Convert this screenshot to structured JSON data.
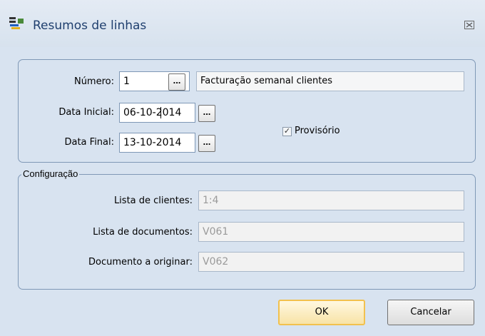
{
  "window": {
    "title": "Resumos de linhas"
  },
  "form": {
    "numero_label": "Número:",
    "numero_value": "1",
    "numero_desc": "Facturação semanal clientes",
    "data_inicial_label": "Data Inicial:",
    "data_inicial_value": "06-10-2014",
    "data_final_label": "Data Final:",
    "data_final_value": "13-10-2014",
    "provisorio_label": "Provisório",
    "provisorio_checked": true,
    "browse_label": "..."
  },
  "config": {
    "legend": "Configuração",
    "lista_clientes_label": "Lista de clientes:",
    "lista_clientes_value": "1:4",
    "lista_documentos_label": "Lista de documentos:",
    "lista_documentos_value": "V061",
    "documento_originar_label": "Documento a originar:",
    "documento_originar_value": "V062"
  },
  "buttons": {
    "ok": "OK",
    "cancel": "Cancelar"
  },
  "colors": {
    "background": "#d8e3f0",
    "title_text": "#1f3f6e",
    "default_button": "#f2c14e"
  }
}
